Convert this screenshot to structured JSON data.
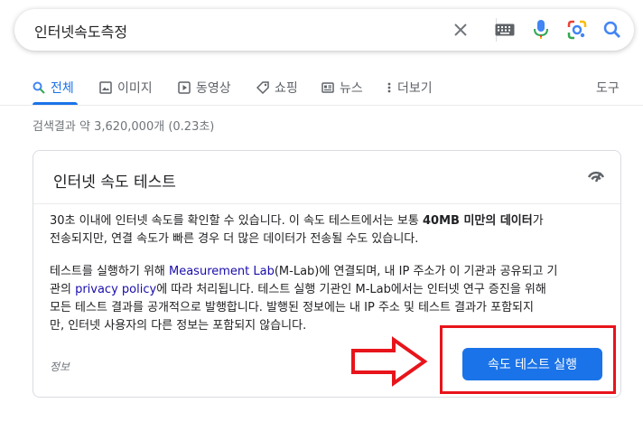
{
  "search": {
    "query": "인터넷속도측정"
  },
  "icons": {
    "clear": "close-icon",
    "keyboard": "keyboard-icon",
    "voice": "mic-icon",
    "lens": "google-lens-icon",
    "search": "search-icon"
  },
  "tabs": {
    "all": "전체",
    "images": "이미지",
    "videos": "동영상",
    "shopping": "쇼핑",
    "news": "뉴스",
    "more": "더보기",
    "tools": "도구"
  },
  "result_stats": "검색결과 약 3,620,000개 (0.23초)",
  "card": {
    "title": "인터넷 속도 테스트",
    "para1_line1_a": "30초 이내에 인터넷 속도를 확인할 수 있습니다. 이 속도 테스트에서는 보통 ",
    "para1_bold": "40MB 미만의 데이터",
    "para1_line1_b": "가",
    "para1_line2": "전송되지만, 연결 속도가 빠른 경우 더 많은 데이터가 전송될 수도 있습니다.",
    "para2_a": "테스트를 실행하기 위해 ",
    "para2_link1": "Measurement Lab",
    "para2_b": "(M-Lab)에 연결되며, 내 IP 주소가 이 기관과 공유되고 기",
    "para2_c": "관의 ",
    "para2_link2": "privacy policy",
    "para2_d": "에 따라 처리됩니다. 테스트 실행 기관인 M-Lab에서는 인터넷 연구 증진을 위해",
    "para2_line3": "모든 테스트 결과를 공개적으로 발행합니다. 발행된 정보에는 내 IP 주소 및 테스트 결과가 포함되지",
    "para2_line4": "만, 인터넷 사용자의 다른 정보는 포함되지 않습니다.",
    "info_label": "정보",
    "run_button": "속도 테스트 실행"
  },
  "colors": {
    "accent": "#1a73e8",
    "link": "#1a0dab",
    "annotation": "#e8141b"
  }
}
